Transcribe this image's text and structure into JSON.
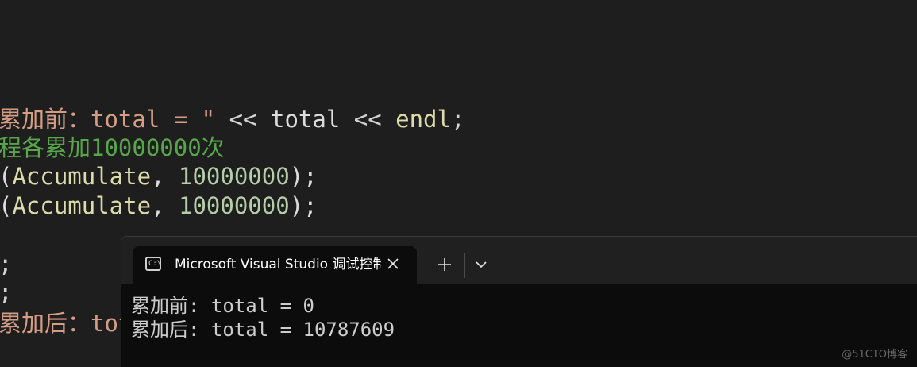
{
  "editor": {
    "line1": {
      "str": "累加前：total = \"",
      "op1": " << ",
      "ident": "total",
      "op2": " << ",
      "func": "endl",
      "end": ";"
    },
    "line2": {
      "comment": "程各累加10000000次"
    },
    "line3": {
      "open": "(",
      "func": "Accumulate",
      "comma": ", ",
      "num": "10000000",
      "close": ");"
    },
    "line4": {
      "open": "(",
      "func": "Accumulate",
      "comma": ", ",
      "num": "10000000",
      "close": ");"
    },
    "line5": {
      "text": ";"
    },
    "line6": {
      "text": ";"
    },
    "line7": {
      "str": "累加后：tot"
    }
  },
  "terminal": {
    "tab_icon_text": "C:\\",
    "tab_title": "Microsoft Visual Studio 调试控制台",
    "output": [
      "累加前: total = 0",
      "累加后: total = 10787609"
    ]
  },
  "watermark": "@51CTO博客",
  "icons": {
    "tab_icon": "console-icon",
    "close": "close-icon",
    "new_tab": "plus-icon",
    "dropdown": "chevron-down-icon"
  }
}
